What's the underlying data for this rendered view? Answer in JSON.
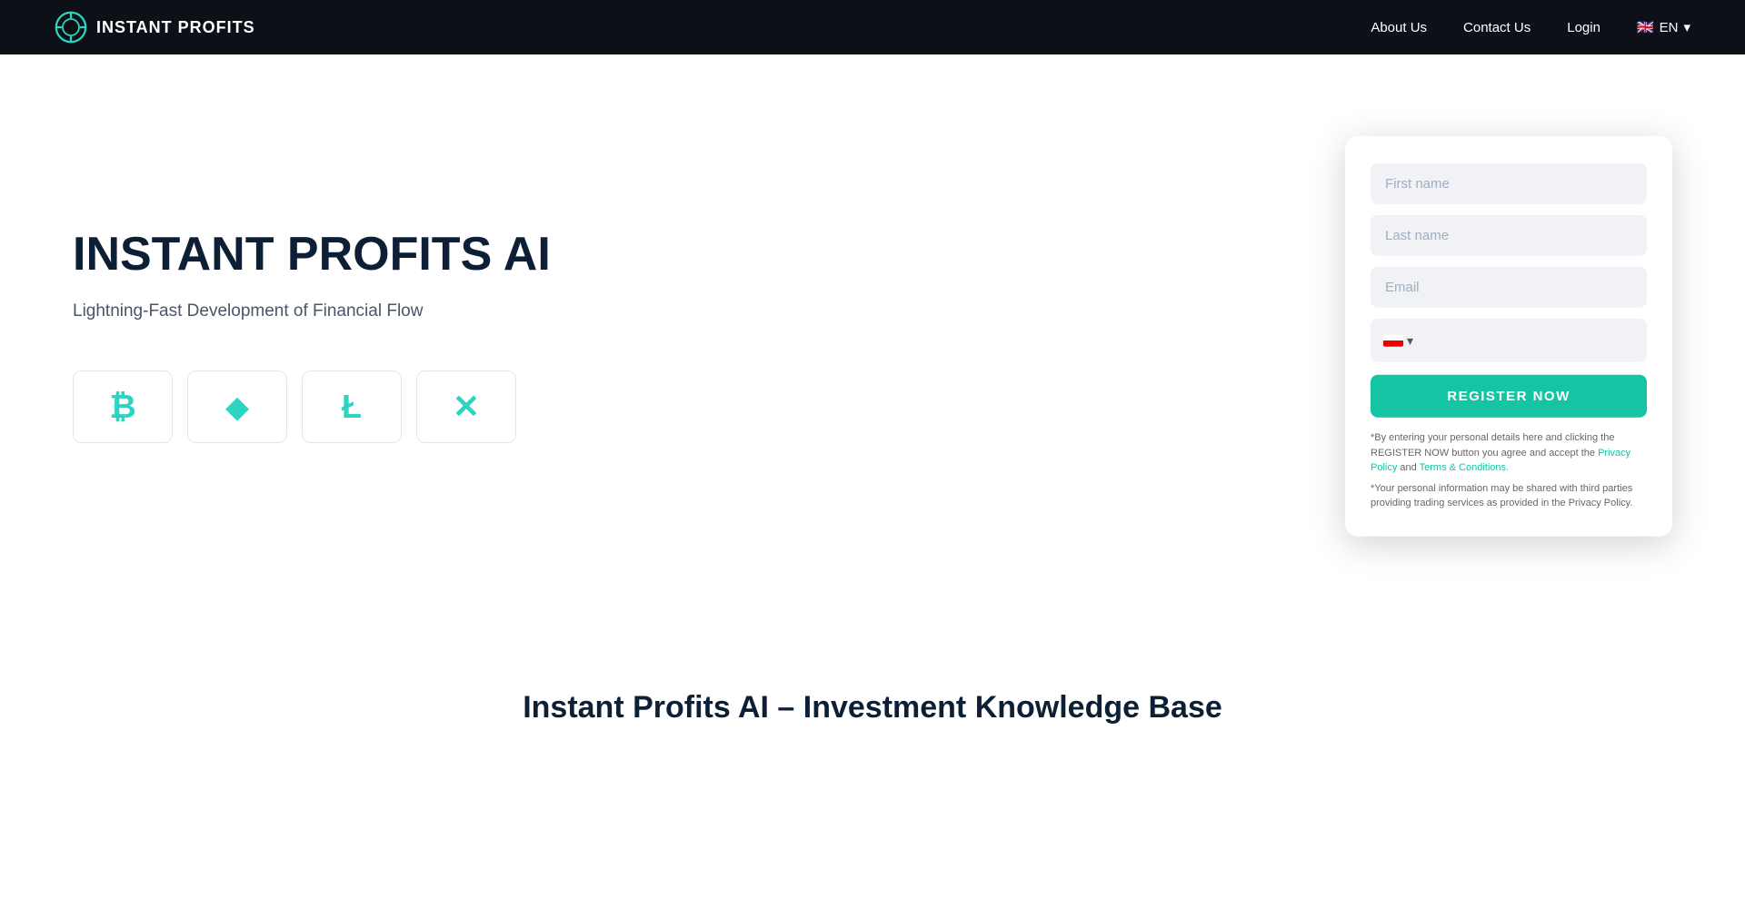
{
  "brand": {
    "name": "INSTANT PROFITS",
    "logo_alt": "Instant Profits Logo"
  },
  "navbar": {
    "links": [
      {
        "label": "About Us",
        "href": "#"
      },
      {
        "label": "Contact Us",
        "href": "#"
      },
      {
        "label": "Login",
        "href": "#"
      }
    ],
    "language": {
      "code": "EN",
      "flag": "🇬🇧"
    }
  },
  "hero": {
    "title": "INSTANT PROFITS AI",
    "subtitle": "Lightning-Fast Development of Financial Flow",
    "crypto_icons": [
      {
        "symbol": "₿",
        "name": "Bitcoin"
      },
      {
        "symbol": "◆",
        "name": "Ethereum"
      },
      {
        "symbol": "Ł",
        "name": "Litecoin"
      },
      {
        "symbol": "✕",
        "name": "Ripple"
      }
    ]
  },
  "form": {
    "first_name_placeholder": "First name",
    "last_name_placeholder": "Last name",
    "email_placeholder": "Email",
    "phone_flag": "PL",
    "phone_code": "+",
    "register_button": "REGISTER NOW",
    "disclaimer1": "*By entering your personal details here and clicking the REGISTER NOW button you agree and accept the ",
    "privacy_policy_link": "Privacy Policy",
    "and_text": " and ",
    "terms_link": "Terms & Conditions.",
    "disclaimer2": "*Your personal information may be shared with third parties providing trading services as provided in the Privacy Policy."
  },
  "knowledge_section": {
    "title": "Instant Profits AI – Investment Knowledge Base"
  }
}
